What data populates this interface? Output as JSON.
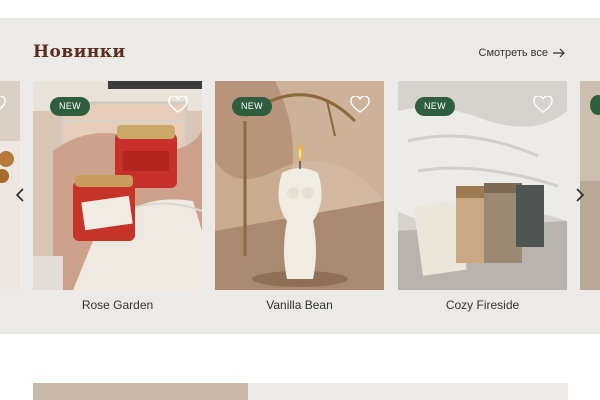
{
  "section": {
    "title": "Новинки",
    "view_all_label": "Смотреть все"
  },
  "products": [
    {
      "name": "Rose Garden",
      "badge": "NEW"
    },
    {
      "name": "Vanilla Bean",
      "badge": "NEW"
    },
    {
      "name": "Cozy Fireside",
      "badge": "NEW"
    }
  ],
  "colors": {
    "badge_bg": "#2f5e3e",
    "band_bg": "#ebeae6",
    "title": "#5a2e1e"
  },
  "icons": {
    "favorite": "heart-icon",
    "prev": "chevron-left-icon",
    "next": "chevron-right-icon",
    "view_all": "arrow-right-icon"
  }
}
